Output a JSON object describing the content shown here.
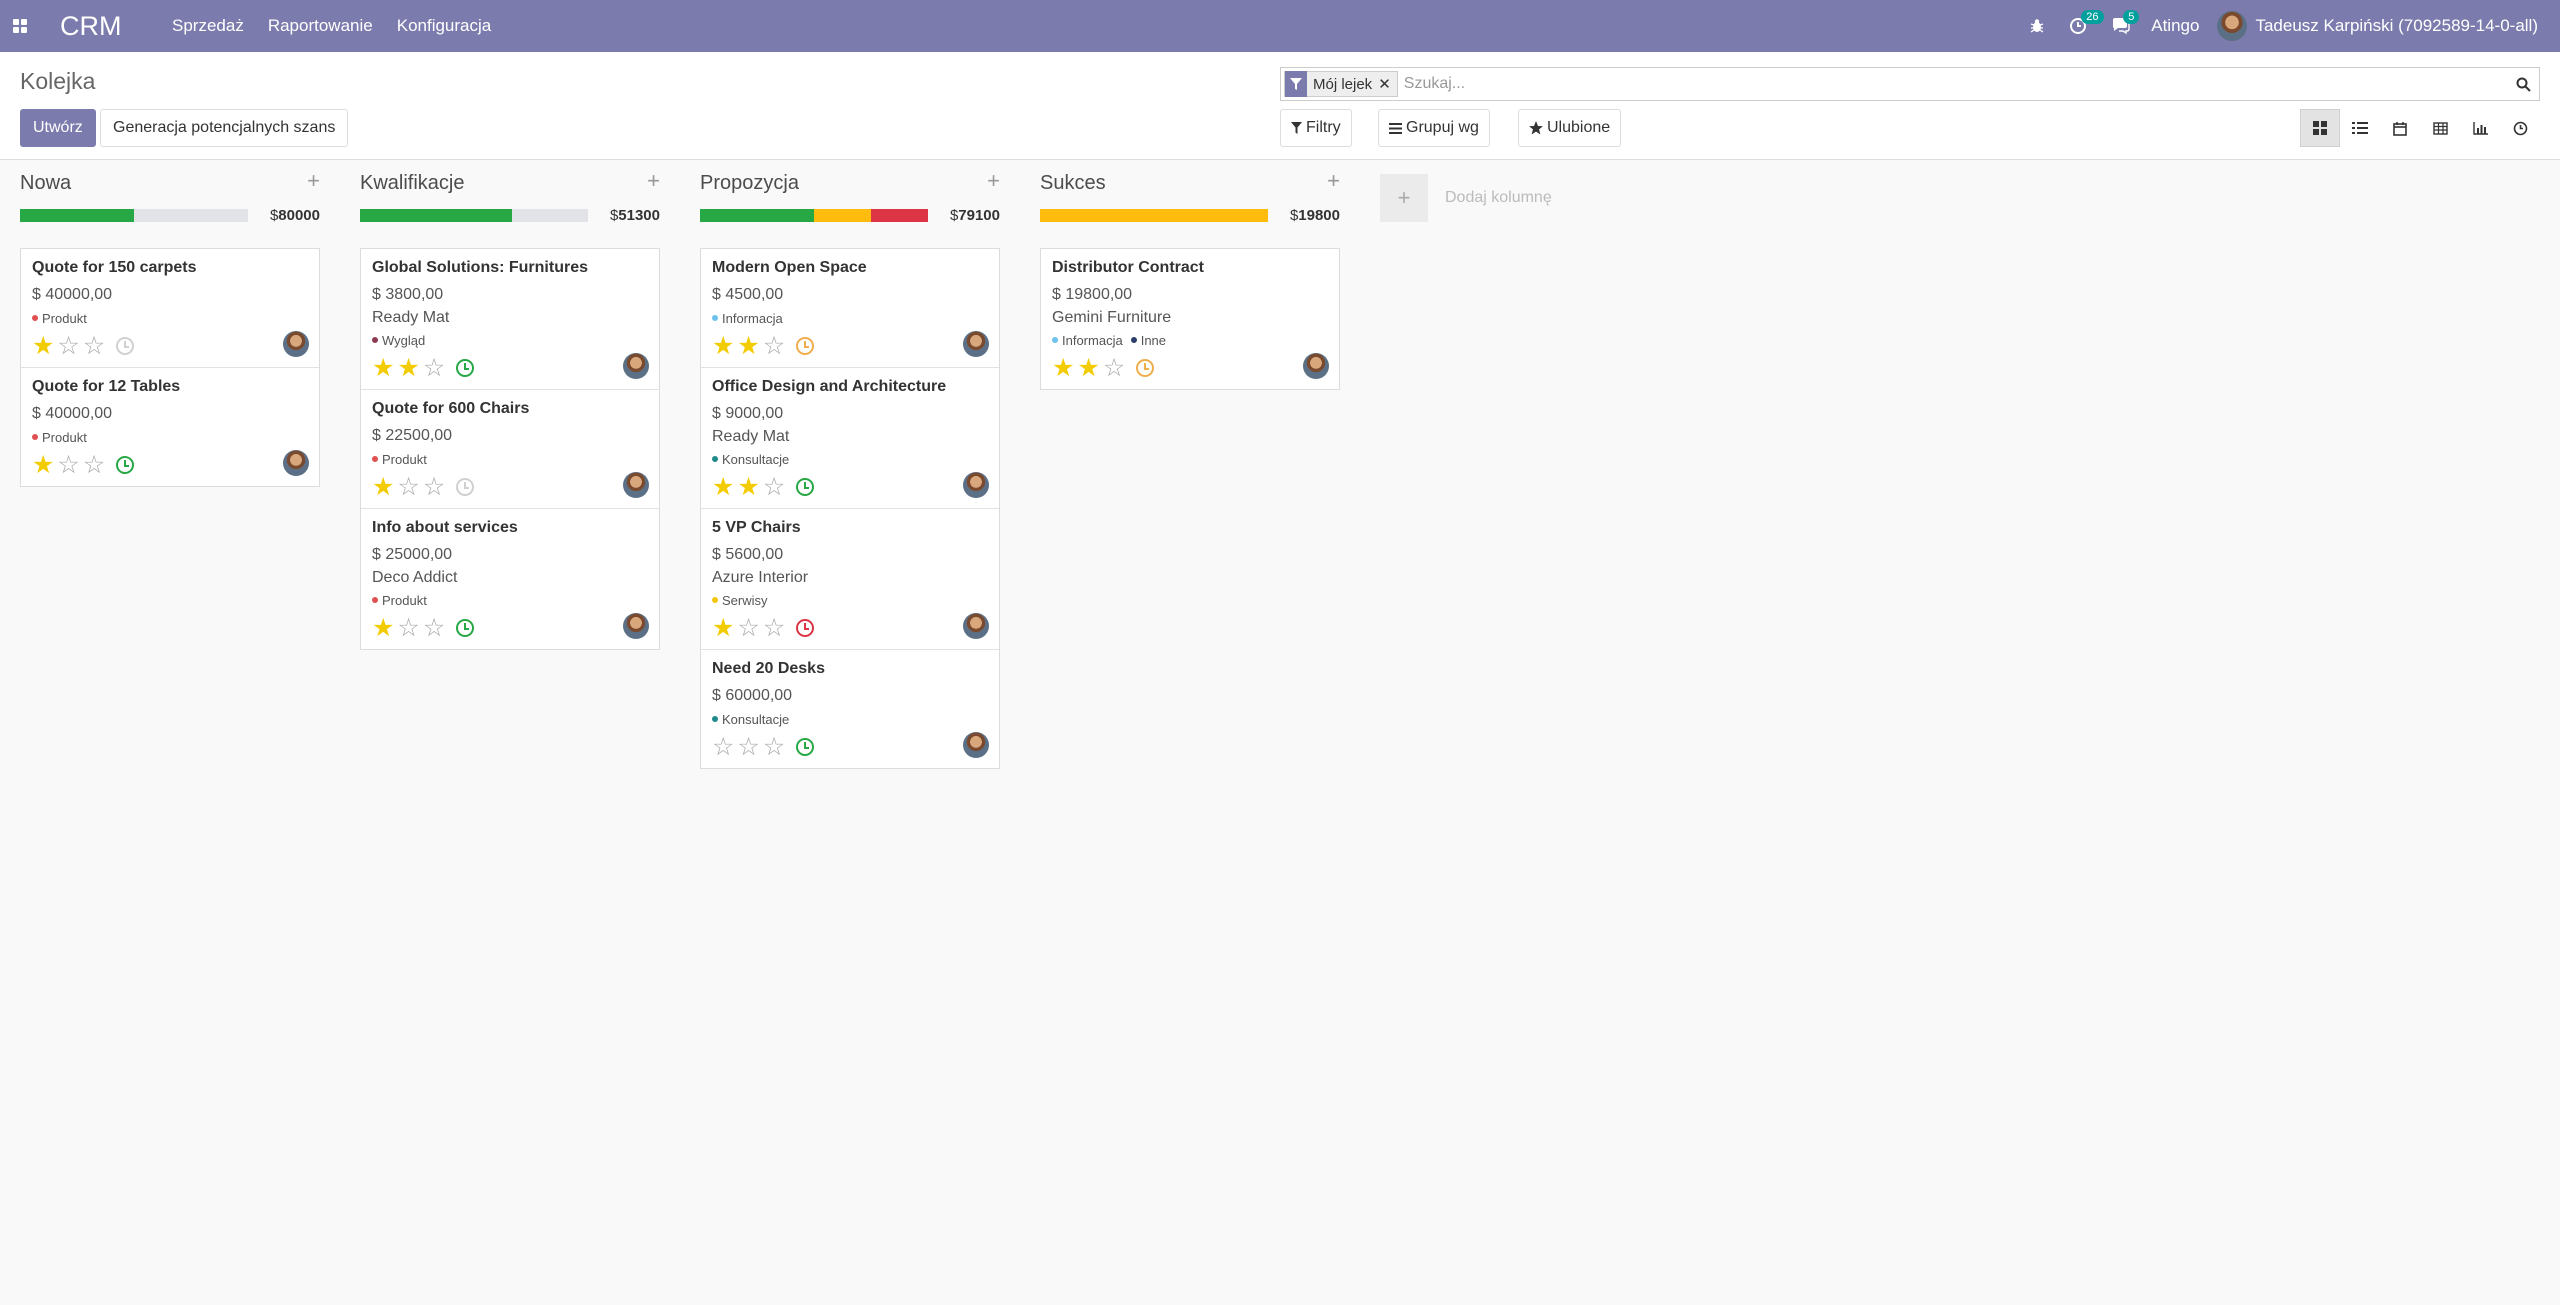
{
  "navbar": {
    "brand": "CRM",
    "menu": [
      "Sprzedaż",
      "Raportowanie",
      "Konfiguracja"
    ],
    "activities_badge": "26",
    "messages_badge": "5",
    "company": "Atingo",
    "user": "Tadeusz Karpiński (7092589-14-0-all)"
  },
  "control": {
    "title": "Kolejka",
    "create_label": "Utwórz",
    "generate_label": "Generacja potencjalnych szans",
    "facet": "Mój lejek",
    "search_placeholder": "Szukaj...",
    "filters_label": "Filtry",
    "groupby_label": "Grupuj wg",
    "favorites_label": "Ulubione"
  },
  "colors": {
    "green": "#28a745",
    "orange": "#ffbb0e",
    "red": "#dc3545",
    "grey": "#e2e3e6",
    "activity_green": "#28a745",
    "activity_orange": "#f0ad4e",
    "activity_red": "#dc3545",
    "activity_none": "#d0d0d0"
  },
  "columns": [
    {
      "title": "Nowa",
      "total": "80000",
      "progress": [
        {
          "color": "#28a745",
          "fraction": 0.5
        }
      ],
      "cards": [
        {
          "title": "Quote for 150 carpets",
          "amount": "$ 40000,00",
          "company": "",
          "tags": [
            {
              "label": "Produkt",
              "color": "#e05050"
            }
          ],
          "stars": 1,
          "activity": "none"
        },
        {
          "title": "Quote for 12 Tables",
          "amount": "$ 40000,00",
          "company": "",
          "tags": [
            {
              "label": "Produkt",
              "color": "#e05050"
            }
          ],
          "stars": 1,
          "activity": "green"
        }
      ]
    },
    {
      "title": "Kwalifikacje",
      "total": "51300",
      "progress": [
        {
          "color": "#28a745",
          "fraction": 0.667
        }
      ],
      "cards": [
        {
          "title": "Global Solutions: Furnitures",
          "amount": "$ 3800,00",
          "company": "Ready Mat",
          "tags": [
            {
              "label": "Wygląd",
              "color": "#8e3b52"
            }
          ],
          "stars": 2,
          "activity": "green"
        },
        {
          "title": "Quote for 600 Chairs",
          "amount": "$ 22500,00",
          "company": "",
          "tags": [
            {
              "label": "Produkt",
              "color": "#e05050"
            }
          ],
          "stars": 1,
          "activity": "none"
        },
        {
          "title": "Info about services",
          "amount": "$ 25000,00",
          "company": "Deco Addict",
          "tags": [
            {
              "label": "Produkt",
              "color": "#e05050"
            }
          ],
          "stars": 1,
          "activity": "green"
        }
      ]
    },
    {
      "title": "Propozycja",
      "total": "79100",
      "progress": [
        {
          "color": "#28a745",
          "fraction": 0.5
        },
        {
          "color": "#ffbb0e",
          "fraction": 0.25
        },
        {
          "color": "#dc3545",
          "fraction": 0.25
        }
      ],
      "cards": [
        {
          "title": "Modern Open Space",
          "amount": "$ 4500,00",
          "company": "",
          "tags": [
            {
              "label": "Informacja",
              "color": "#6cc1ed"
            }
          ],
          "stars": 2,
          "activity": "orange"
        },
        {
          "title": "Office Design and Architecture",
          "amount": "$ 9000,00",
          "company": "Ready Mat",
          "tags": [
            {
              "label": "Konsultacje",
              "color": "#1f8a8c"
            }
          ],
          "stars": 2,
          "activity": "green"
        },
        {
          "title": "5 VP Chairs",
          "amount": "$ 5600,00",
          "company": "Azure Interior",
          "tags": [
            {
              "label": "Serwisy",
              "color": "#f4c609"
            }
          ],
          "stars": 1,
          "activity": "red"
        },
        {
          "title": "Need 20 Desks",
          "amount": "$ 60000,00",
          "company": "",
          "tags": [
            {
              "label": "Konsultacje",
              "color": "#1f8a8c"
            }
          ],
          "stars": 0,
          "activity": "green"
        }
      ]
    },
    {
      "title": "Sukces",
      "total": "19800",
      "progress": [
        {
          "color": "#ffbb0e",
          "fraction": 1.0
        }
      ],
      "cards": [
        {
          "title": "Distributor Contract",
          "amount": "$ 19800,00",
          "company": "Gemini Furniture",
          "tags": [
            {
              "label": "Informacja",
              "color": "#6cc1ed"
            },
            {
              "label": "Inne",
              "color": "#2c3e6b"
            }
          ],
          "stars": 2,
          "activity": "orange"
        }
      ]
    }
  ],
  "add_column_label": "Dodaj kolumnę"
}
